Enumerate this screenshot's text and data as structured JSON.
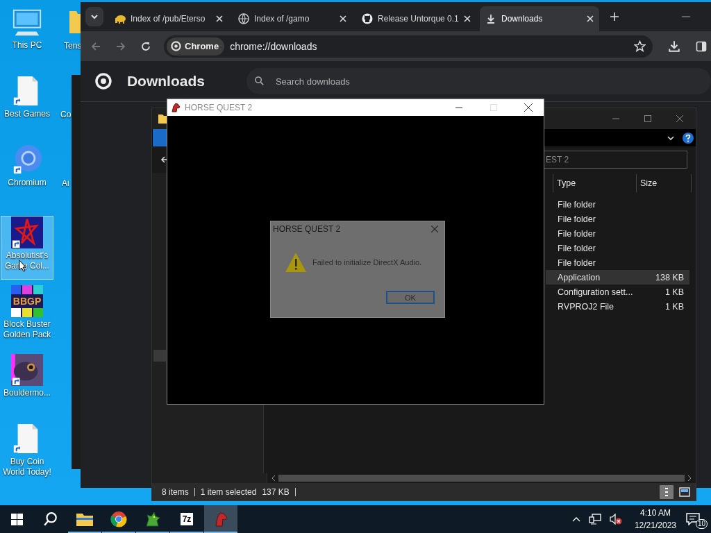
{
  "desktop_icons": [
    {
      "kind": "pc",
      "label": "This PC",
      "selected": false
    },
    {
      "kind": "document",
      "label": "Best Games",
      "selected": false
    },
    {
      "kind": "chromium",
      "label": "Chromium",
      "selected": false
    },
    {
      "kind": "star",
      "label": "Absolutist's Game Col...",
      "selected": true
    },
    {
      "kind": "blocks",
      "label": "Block Buster Golden Pack",
      "icon_text": "BBGP",
      "selected": false
    },
    {
      "kind": "creature",
      "label": "Bouldermo...",
      "selected": false
    },
    {
      "kind": "document",
      "label": "Buy Coin World Today!",
      "selected": false
    }
  ],
  "desktop_icons_partial": [
    {
      "label": "Tens"
    },
    {
      "label": "Co"
    },
    {
      "label": "Ai"
    }
  ],
  "browser": {
    "tabs": [
      {
        "kind": "elephant",
        "title": "Index of /pub/Eterso",
        "selected": false
      },
      {
        "kind": "globe",
        "title": "Index of /gamo",
        "selected": false
      },
      {
        "kind": "github",
        "title": "Release Untorque 0.1",
        "selected": false
      },
      {
        "kind": "download",
        "title": "Downloads",
        "selected": true
      }
    ],
    "url_chip": "Chrome",
    "url": "chrome://downloads",
    "page_title": "Downloads",
    "search": {
      "placeholder": "Search downloads"
    }
  },
  "explorer": {
    "address": "EST 2",
    "columns": [
      "Type",
      "Size"
    ],
    "rows": [
      {
        "type": "File folder",
        "selected": false
      },
      {
        "type": "File folder",
        "selected": false
      },
      {
        "type": "File folder",
        "selected": false
      },
      {
        "type": "File folder",
        "selected": false
      },
      {
        "type": "File folder",
        "selected": false
      },
      {
        "type": "Application",
        "size": "138 KB",
        "selected": true
      },
      {
        "type": "Configuration sett...",
        "size": "1 KB",
        "selected": false
      },
      {
        "type": "RVPROJ2 File",
        "size": "1 KB",
        "selected": false
      }
    ],
    "status": {
      "items": "8 items",
      "selection": "1 item selected",
      "size": "137 KB"
    }
  },
  "game_window": {
    "title": "HORSE QUEST 2"
  },
  "dialog": {
    "title": "HORSE QUEST 2",
    "message": "Failed to initialize DirectX Audio.",
    "buttons": [
      "OK"
    ]
  },
  "taskbar": {
    "apps": [
      {
        "kind": "folder",
        "running": true,
        "active": false
      },
      {
        "kind": "chrome",
        "running": true,
        "active": false
      },
      {
        "kind": "dragon",
        "running": true,
        "active": false
      },
      {
        "kind": "sevenzip",
        "label": "7z",
        "running": true,
        "active": false
      },
      {
        "kind": "horse",
        "running": true,
        "active": true
      }
    ],
    "time": "4:10 AM",
    "date": "12/21/2023",
    "notifications": "10"
  }
}
